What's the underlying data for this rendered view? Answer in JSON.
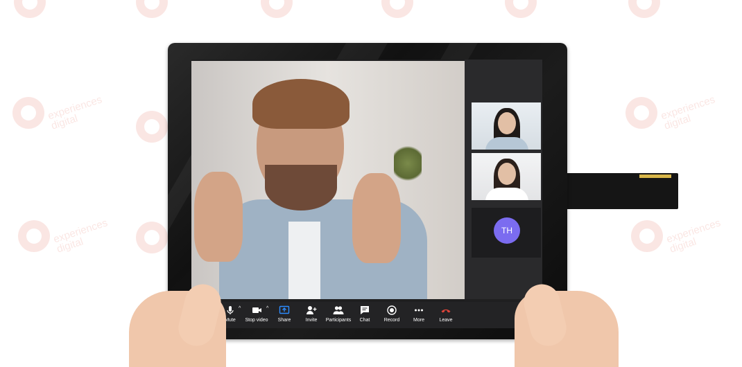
{
  "watermark": {
    "line1": "experiences",
    "line2": "digital"
  },
  "meeting": {
    "participants": [
      {
        "name": "main-speaker"
      },
      {
        "name": "participant-1"
      },
      {
        "name": "participant-2"
      },
      {
        "initials": "TH",
        "avatar_color": "#7b6cf0"
      }
    ]
  },
  "toolbar": {
    "mute_label": "Mute",
    "stop_video_label": "Stop video",
    "share_label": "Share",
    "invite_label": "Invite",
    "participants_label": "Participants",
    "chat_label": "Chat",
    "record_label": "Record",
    "more_label": "More",
    "leave_label": "Leave",
    "leave_color": "#e0453a",
    "share_color": "#2d8cff"
  }
}
